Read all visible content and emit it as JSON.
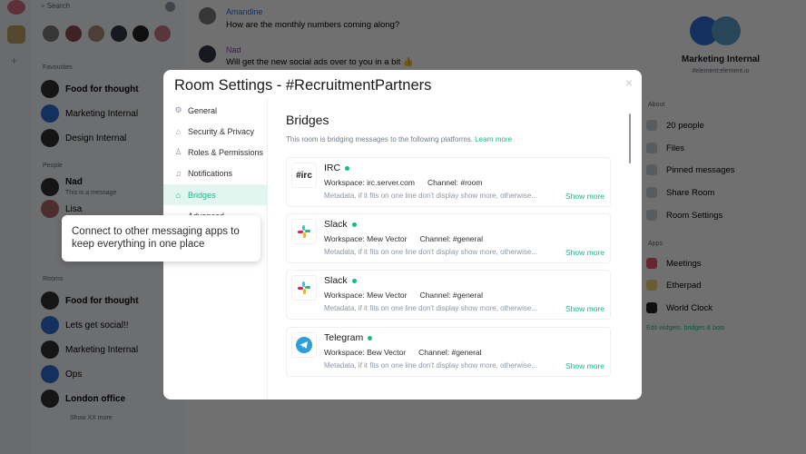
{
  "roomlist": {
    "search_placeholder": "Search",
    "favourites_label": "Favourites",
    "favourites": [
      "Food for thought",
      "Marketing Internal",
      "Design Internal"
    ],
    "people_label": "People",
    "people": [
      {
        "name": "Nad",
        "preview": "This is a message"
      },
      {
        "name": "Lisa"
      }
    ],
    "rooms_label": "Rooms",
    "rooms": [
      "Food for thought",
      "Lets get social!!",
      "Marketing Internal",
      "Ops",
      "London office"
    ],
    "show_more": "Show XX more"
  },
  "chat": {
    "messages": [
      {
        "sender": "Amandine",
        "text": "How are the monthly numbers coming along?"
      },
      {
        "sender": "Nad",
        "text": "Will get the new social ads over to you in a bit 👍"
      }
    ]
  },
  "right_panel": {
    "room_name": "Marketing Internal",
    "room_alias": "#element:element.io",
    "about_label": "About",
    "about_items": [
      "20 people",
      "Files",
      "Pinned messages",
      "Share Room",
      "Room Settings"
    ],
    "apps_label": "Apps",
    "apps": [
      "Meetings",
      "Etherpad",
      "World Clock"
    ],
    "edit_link": "Edit widgets, bridges & bots"
  },
  "modal": {
    "title": "Room Settings - #RecruitmentPartners",
    "close": "×",
    "nav": [
      {
        "label": "General",
        "icon": "⚙"
      },
      {
        "label": "Security & Privacy",
        "icon": "🔒"
      },
      {
        "label": "Roles & Permissions",
        "icon": "♙"
      },
      {
        "label": "Notifications",
        "icon": "🔔"
      },
      {
        "label": "Bridges",
        "icon": "🔒"
      },
      {
        "label": "Advanced",
        "icon": ""
      }
    ],
    "heading": "Bridges",
    "description": "This room is bridging messages to the following platforms.",
    "learn_more": "Learn more",
    "bridges": [
      {
        "name": "IRC",
        "logo": "#irc",
        "workspace": "Workspace: irc.server.com",
        "channel": "Channel: #room",
        "meta": "Metadata, if it fits on one line don't display show more, otherwise...",
        "show_more": "Show more"
      },
      {
        "name": "Slack",
        "logo": "slack",
        "workspace": "Workspace: Mew Vector",
        "channel": "Channel: #general",
        "meta": "Metadata, if it fits on one line don't display show more, otherwise...",
        "show_more": "Show more"
      },
      {
        "name": "Slack",
        "logo": "slack",
        "workspace": "Workspace: Mew Vector",
        "channel": "Channel: #general",
        "meta": "Metadata, if it fits on one line don't display show more, otherwise...",
        "show_more": "Show more"
      },
      {
        "name": "Telegram",
        "logo": "telegram",
        "workspace": "Workspace: Bew Vector",
        "channel": "Channel: #general",
        "meta": "Metadata, if it fits on one line don't display show more, otherwise...",
        "show_more": "Show more"
      }
    ]
  },
  "tooltip": {
    "text": "Connect to other messaging apps to keep everything in one place"
  },
  "colors": {
    "accent": "#0dbd8b",
    "online": "#0dbd8b"
  }
}
